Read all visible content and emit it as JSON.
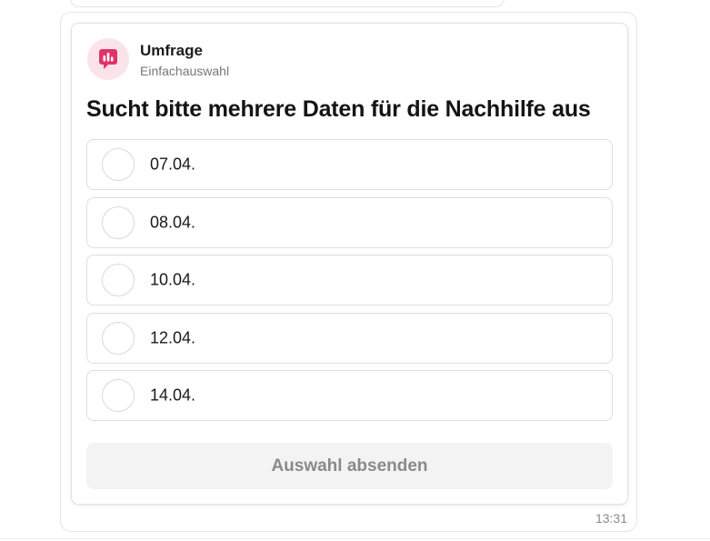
{
  "poll": {
    "type": "Umfrage",
    "subtype": "Einfachauswahl",
    "icon": "poll-chart-icon",
    "accent_color": "#e0336a",
    "question": "Sucht bitte mehrere Daten für die Nachhilfe aus",
    "options": [
      {
        "label": "07.04.",
        "selected": false
      },
      {
        "label": "08.04.",
        "selected": false
      },
      {
        "label": "10.04.",
        "selected": false
      },
      {
        "label": "12.04.",
        "selected": false
      },
      {
        "label": "14.04.",
        "selected": false
      }
    ],
    "submit_label": "Auswahl absenden",
    "submit_enabled": false
  },
  "message": {
    "time": "13:31"
  }
}
